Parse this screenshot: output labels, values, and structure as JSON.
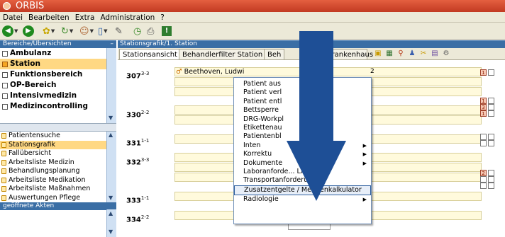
{
  "app": {
    "title": "ORBIS"
  },
  "menubar": [
    "Datei",
    "Bearbeiten",
    "Extra",
    "Administration",
    "?"
  ],
  "sidebar": {
    "header": "Bereiche/Übersichten",
    "collapse_glyph": "–",
    "areas": [
      {
        "label": "Ambulanz",
        "selected": false
      },
      {
        "label": "Station",
        "selected": true
      },
      {
        "label": "Funktionsbereich",
        "selected": false
      },
      {
        "label": "OP-Bereich",
        "selected": false
      },
      {
        "label": "Intensivmedizin",
        "selected": false
      },
      {
        "label": "Medizincontrolling",
        "selected": false
      }
    ],
    "functions": [
      {
        "label": "Patientensuche",
        "selected": false
      },
      {
        "label": "Stationsgrafik",
        "selected": true
      },
      {
        "label": "Fallübersicht",
        "selected": false
      },
      {
        "label": "Arbeitsliste Medizin",
        "selected": false
      },
      {
        "label": "Behandlungsplanung",
        "selected": false
      },
      {
        "label": "Arbeitsliste Medikation",
        "selected": false
      },
      {
        "label": "Arbeitsliste Maßnahmen",
        "selected": false
      },
      {
        "label": "Auswertungen Pflege",
        "selected": false
      }
    ],
    "open_files_header": "geöffnete Akten"
  },
  "panel": {
    "header": "Stationsgrafik/1. Station",
    "tabs": [
      "Stationsansicht",
      "Behandlerfilter Station",
      "Beh",
      "Krankenhaus"
    ]
  },
  "rooms": [
    {
      "number": "307",
      "sup": "3-3"
    },
    {
      "number": "330",
      "sup": "2-2"
    },
    {
      "number": "331",
      "sup": "1-1"
    },
    {
      "number": "332",
      "sup": "3-3"
    },
    {
      "number": "333",
      "sup": "1-1"
    },
    {
      "number": "334",
      "sup": "2-2"
    }
  ],
  "patient": {
    "name": "Beethoven, Ludwi",
    "bed_extra": "2"
  },
  "indicators": [
    "1",
    "1",
    "3",
    "1",
    "2"
  ],
  "context_menu": [
    {
      "label": "Patient aus",
      "submenu": false,
      "highlight": false
    },
    {
      "label": "Patient verl",
      "submenu": false,
      "highlight": false
    },
    {
      "label": "Patient entl",
      "submenu": false,
      "highlight": false
    },
    {
      "label": "Bettsperre",
      "submenu": false,
      "highlight": false
    },
    {
      "label": "DRG-Workpl",
      "submenu": false,
      "highlight": false
    },
    {
      "label": "Etikettenau",
      "submenu": false,
      "highlight": false
    },
    {
      "label": "Patientenbl",
      "submenu": false,
      "highlight": false
    },
    {
      "label": "Inten",
      "submenu": true,
      "highlight": false
    },
    {
      "label": "Korrektu",
      "submenu": true,
      "highlight": false
    },
    {
      "label": "Dokumente",
      "submenu": true,
      "highlight": false
    },
    {
      "label": "Laboranforde... LAURIS",
      "submenu": false,
      "highlight": false
    },
    {
      "label": "Transportanforderung",
      "submenu": false,
      "highlight": false
    },
    {
      "label": "Zusatzentgelte / Mengenkalkulator",
      "submenu": false,
      "highlight": true
    },
    {
      "label": "Radiologie",
      "submenu": true,
      "highlight": false
    }
  ],
  "colors": {
    "accent": "#3a6ea5",
    "titlebar": "#c23a22",
    "selection": "#ffd883",
    "arrow": "#1e4f96"
  }
}
